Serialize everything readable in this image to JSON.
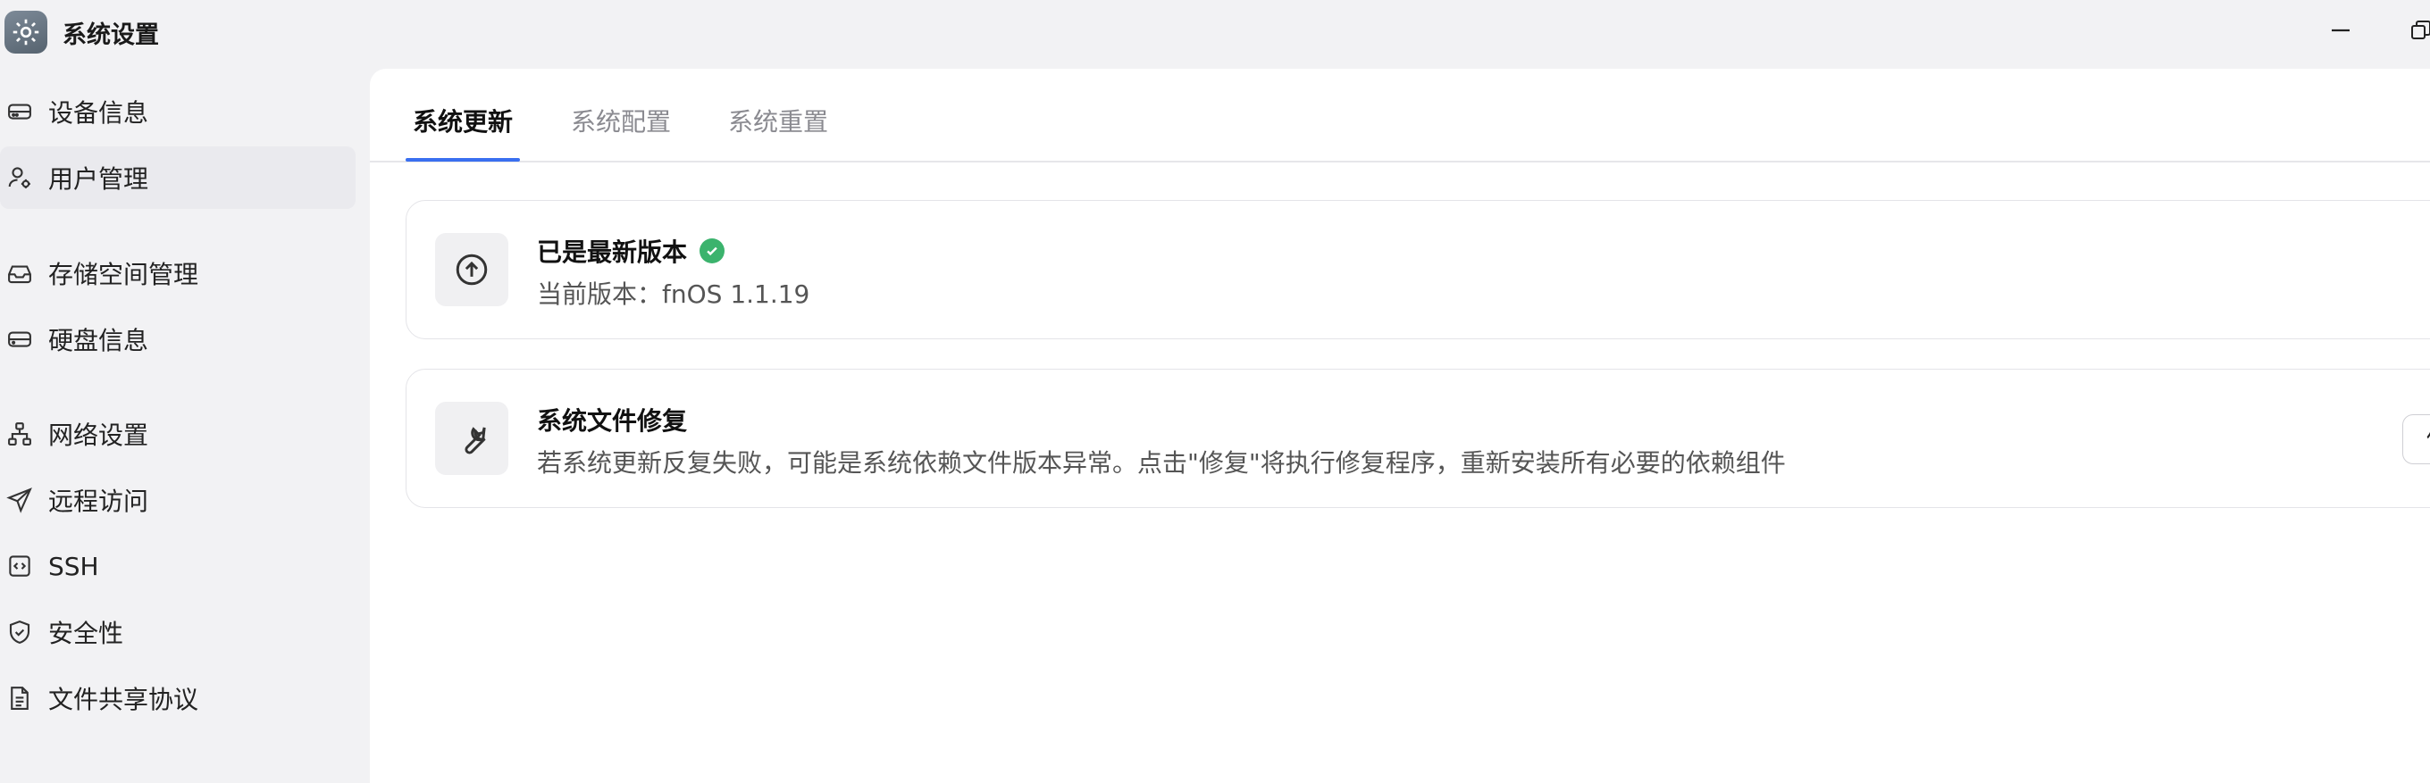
{
  "app": {
    "title": "系统设置",
    "icon": "gear-app-icon"
  },
  "window_controls": {
    "minimize_icon": "minimize-icon",
    "restore_icon": "restore-icon"
  },
  "sidebar": {
    "items": [
      {
        "label": "设备信息",
        "icon": "device-info-icon"
      },
      {
        "label": "用户管理",
        "icon": "user-management-icon",
        "active": true
      },
      {
        "label": "存储空间管理",
        "icon": "storage-icon"
      },
      {
        "label": "硬盘信息",
        "icon": "disk-icon"
      },
      {
        "label": "网络设置",
        "icon": "network-icon"
      },
      {
        "label": "远程访问",
        "icon": "send-icon"
      },
      {
        "label": "SSH",
        "icon": "ssh-icon"
      },
      {
        "label": "安全性",
        "icon": "shield-icon"
      },
      {
        "label": "文件共享协议",
        "icon": "document-icon"
      }
    ]
  },
  "tabs": [
    {
      "label": "系统更新",
      "active": true
    },
    {
      "label": "系统配置"
    },
    {
      "label": "系统重置"
    }
  ],
  "update_card": {
    "title": "已是最新版本",
    "version_label": "当前版本：fnOS 1.1.19",
    "icon": "upload-arrow-icon",
    "status_icon": "check-circle-icon",
    "status_color": "#3bb36d"
  },
  "repair_card": {
    "title": "系统文件修复",
    "description": "若系统更新反复失败，可能是系统依赖文件版本异常。点击\"修复\"将执行修复程序，重新安装所有必要的依赖组件",
    "button_label": "修复",
    "icon": "wrench-icon"
  },
  "colors": {
    "accent": "#3a6ff0",
    "background": "#f2f2f4",
    "panel": "#ffffff"
  }
}
